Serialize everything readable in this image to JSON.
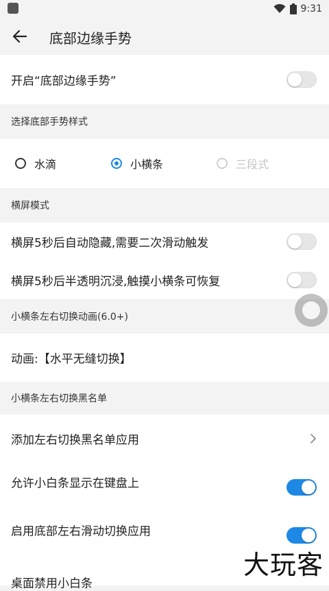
{
  "status_bar": {
    "time": "9:31",
    "icons": [
      "app-square-icon",
      "wifi-icon",
      "battery-icon"
    ]
  },
  "app_bar": {
    "title": "底部边缘手势",
    "back_icon": "arrow-left-icon"
  },
  "toggles": {
    "enable_gesture": {
      "label": "开启“底部边缘手势”",
      "on": false
    }
  },
  "sections": {
    "style": "选择底部手势样式",
    "landscape": "横屏模式",
    "animation": "小横条左右切换动画(6.0+)",
    "blacklist": "小横条左右切换黑名单"
  },
  "style_options": [
    {
      "label": "水滴",
      "checked": false,
      "disabled": false
    },
    {
      "label": "小横条",
      "checked": true,
      "disabled": false
    },
    {
      "label": "三段式",
      "checked": false,
      "disabled": true
    }
  ],
  "landscape_items": [
    {
      "label": "横屏5秒后自动隐藏,需要二次滑动触发",
      "on": false
    },
    {
      "label": "横屏5秒后半透明沉浸,触摸小横条可恢复",
      "on": false
    }
  ],
  "animation_item": {
    "label": "动画:【水平无缝切换】"
  },
  "blacklist_items": [
    {
      "label": "添加左右切换黑名单应用",
      "type": "link"
    },
    {
      "label": "允许小白条显示在键盘上",
      "on": true
    },
    {
      "label": "启用底部左右滑动切换应用",
      "on": true
    },
    {
      "label": "桌面禁用小白条",
      "on": false
    }
  ],
  "watermark": "大玩客",
  "colors": {
    "accent": "#1e88e5",
    "background": "#f3f3f3",
    "card": "#ffffff"
  }
}
